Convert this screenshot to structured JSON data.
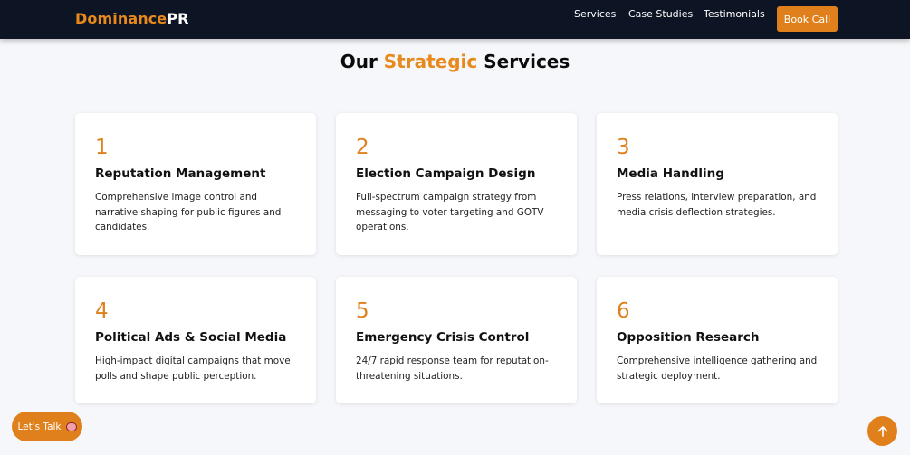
{
  "header": {
    "logo_part1": "Dominance",
    "logo_part2": "PR",
    "nav": [
      {
        "label": "Services"
      },
      {
        "label": "Case Studies"
      },
      {
        "label": "Testimonials"
      }
    ],
    "cta_label": "Book Call"
  },
  "section": {
    "title_part1": "Our ",
    "title_accent": "Strategic",
    "title_part2": " Services"
  },
  "services": [
    {
      "number": "1",
      "title": "Reputation Management",
      "description": "Comprehensive image control and narrative shaping for public figures and candidates."
    },
    {
      "number": "2",
      "title": "Election Campaign Design",
      "description": "Full-spectrum campaign strategy from messaging to voter targeting and GOTV operations."
    },
    {
      "number": "3",
      "title": "Media Handling",
      "description": "Press relations, interview preparation, and media crisis deflection strategies."
    },
    {
      "number": "4",
      "title": "Political Ads & Social Media",
      "description": "High-impact digital campaigns that move polls and shape public perception."
    },
    {
      "number": "5",
      "title": "Emergency Crisis Control",
      "description": "24/7 rapid response team for reputation-threatening situations."
    },
    {
      "number": "6",
      "title": "Opposition Research",
      "description": "Comprehensive intelligence gathering and strategic deployment."
    }
  ],
  "floating": {
    "lets_talk_label": "Let's Talk",
    "lets_talk_icon": "speech-bubble-icon",
    "scroll_top_icon": "arrow-up-icon"
  },
  "colors": {
    "accent": "#e0801c",
    "header_bg": "#0d1424",
    "page_bg": "#f6f7fa"
  }
}
